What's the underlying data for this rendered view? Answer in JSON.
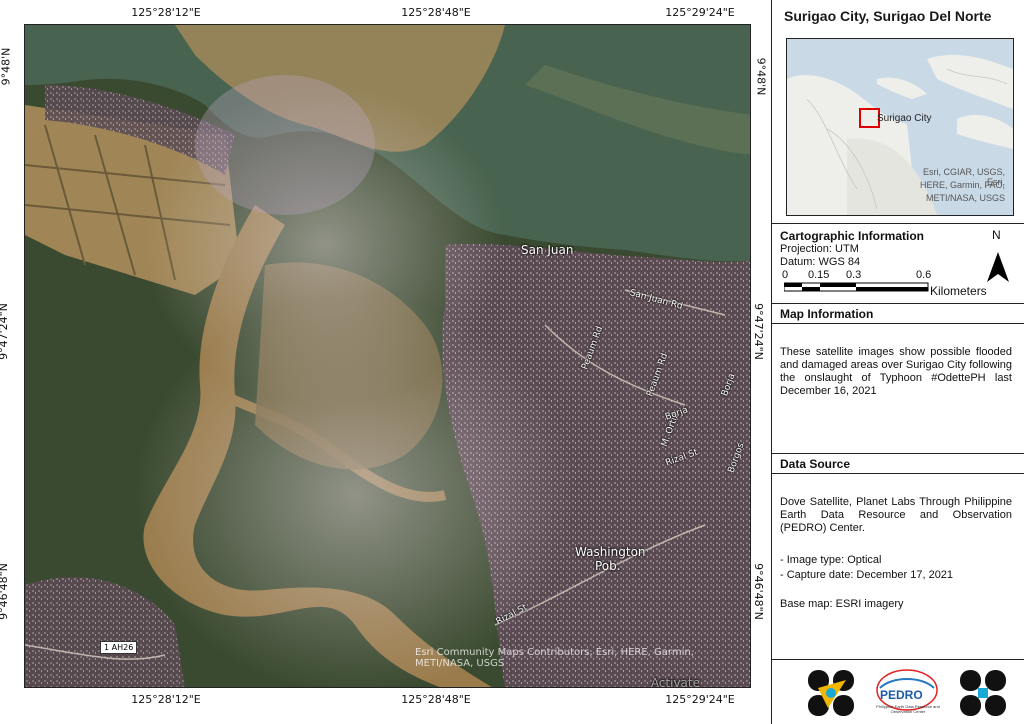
{
  "map": {
    "top_ticks": [
      "125°28'12\"E",
      "125°28'48\"E",
      "125°29'24\"E"
    ],
    "bottom_ticks": [
      "125°28'12\"E",
      "125°28'48\"E",
      "125°29'24\"E"
    ],
    "left_ticks": [
      "9°48'N",
      "9°47'24\"N",
      "9°46'48\"N"
    ],
    "right_ticks": [
      "9°48'N",
      "9°47'24\"N",
      "9°46'48\"N"
    ],
    "places": {
      "san_juan": "San Juan",
      "washington_line1": "Washington",
      "washington_line2": "Pob."
    },
    "roads": {
      "san_juan_rd": "San Juan Rd",
      "peaum_rd_1": "Peaum Rd",
      "peaum_rd_2": "Peaum Rd",
      "m_ortiz": "M. Ortiz",
      "rizal_st_1": "Rizal St",
      "rizal_st_2": "Rizal St",
      "borja_1": "Borja",
      "borja_2": "Borja",
      "borgos": "Borgos"
    },
    "shield": "1 AH26",
    "credit": "Esri Community Maps Contributors, Esri, HERE, Garmin, METI/NASA, USGS",
    "watermark": "Activate"
  },
  "panel": {
    "title": "Surigao City, Surigao Del Norte",
    "inset": {
      "label": "Surigao City",
      "credit_lines": [
        "Esri, CGIAR, USGS, Esri,",
        "HERE, Garmin, FAO,",
        "METI/NASA, USGS"
      ]
    },
    "cartographic": {
      "header": "Cartographic Information",
      "projection": "Projection: UTM",
      "datum": "Datum: WGS 84",
      "scale_ticks": [
        "0",
        "0.15",
        "0.3",
        "0.6"
      ],
      "scale_unit": "Kilometers",
      "north": "N"
    },
    "map_info": {
      "header": "Map Information",
      "text": "These satellite images show possible flooded and damaged areas over Surigao City following the onslaught of Typhoon #OdettePH last December 16, 2021"
    },
    "data_source": {
      "header": "Data Source",
      "text": "Dove Satellite, Planet Labs Through Philippine Earth Data Resource and Observation (PEDRO) Center.",
      "image_type": "- Image type: Optical",
      "capture_date": "- Capture date: December 17, 2021",
      "base_map": "Base map: ESRI imagery"
    },
    "logos": {
      "pedro": "PEDRO",
      "pedro_sub": "Philippine Earth Data Resource and Observation Center"
    }
  },
  "colors": {
    "sea": "#3f5a4a",
    "silt": "#a88a5a",
    "flood": "#8f7447",
    "urban": "#5a4a52",
    "veg": "#2f3f28",
    "inset_box": "#e00000"
  }
}
